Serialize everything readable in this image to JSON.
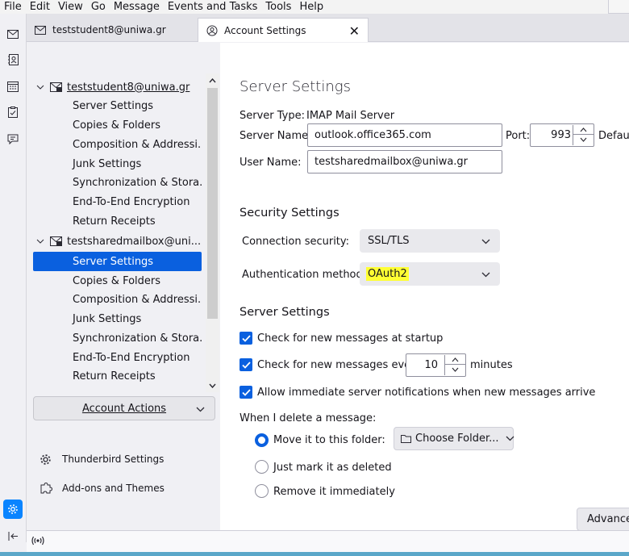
{
  "menubar": {
    "items": [
      "File",
      "Edit",
      "View",
      "Go",
      "Message",
      "Events and Tasks",
      "Tools",
      "Help"
    ]
  },
  "spaces": {
    "icons": [
      "mail-icon",
      "address-book-icon",
      "calendar-icon",
      "tasks-icon",
      "chat-icon"
    ],
    "bottom": [
      "settings-icon",
      "collapse-icon"
    ]
  },
  "tabs": [
    {
      "label": "teststudent8@uniwa.gr",
      "icon": "mail-icon"
    },
    {
      "label": "Account Settings",
      "icon": "account-settings-icon",
      "close": "✕"
    }
  ],
  "sidebar": {
    "accounts": [
      {
        "name": "teststudent8@uniwa.gr",
        "items": [
          "Server Settings",
          "Copies & Folders",
          "Composition & Addressi...",
          "Junk Settings",
          "Synchronization & Stora...",
          "End-To-End Encryption",
          "Return Receipts"
        ]
      },
      {
        "name": "testsharedmailbox@uni...",
        "items": [
          "Server Settings",
          "Copies & Folders",
          "Composition & Addressi...",
          "Junk Settings",
          "Synchronization & Stora...",
          "End-To-End Encryption",
          "Return Receipts"
        ],
        "selected_index": 0
      }
    ],
    "account_actions": "Account Actions",
    "footer": [
      {
        "label": "Thunderbird Settings",
        "icon": "gear-icon"
      },
      {
        "label": "Add-ons and Themes",
        "icon": "puzzle-icon"
      }
    ]
  },
  "content": {
    "title": "Server Settings",
    "server_type_label": "Server Type:",
    "server_type_value": "IMAP Mail Server",
    "server_name_label": "Server Name:",
    "server_name_value": "outlook.office365.com",
    "port_label": "Port:",
    "port_value": "993",
    "default_label": "Default:",
    "user_name_label": "User Name:",
    "user_name_value": "testsharedmailbox@uniwa.gr",
    "security_heading": "Security Settings",
    "connection_security_label": "Connection security:",
    "connection_security_value": "SSL/TLS",
    "auth_method_label": "Authentication method:",
    "auth_method_value": "OAuth2",
    "server_heading": "Server Settings",
    "check_startup": "Check for new messages at startup",
    "check_every_before": "Check for new messages every",
    "check_every_value": "10",
    "check_every_after": "minutes",
    "allow_notifications": "Allow immediate server notifications when new messages arrive",
    "delete_heading": "When I delete a message:",
    "delete_options": [
      "Move it to this folder:",
      "Just mark it as deleted",
      "Remove it immediately"
    ],
    "delete_selected": 0,
    "choose_folder": "Choose Folder...",
    "advanced_button": "Advanced..."
  },
  "colors": {
    "accent": "#0a60df",
    "highlight": "#ffff33"
  }
}
